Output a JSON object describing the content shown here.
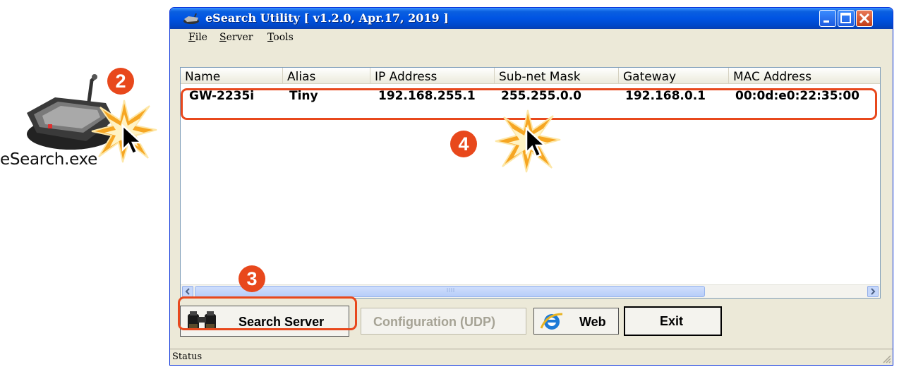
{
  "desktop": {
    "icon_name": "network-device-icon",
    "icon_label": "eSearch.exe"
  },
  "steps": {
    "step2": "2",
    "step3": "3",
    "step4": "4"
  },
  "window": {
    "title": "eSearch Utility [ v1.2.0, Apr.17, 2019 ]",
    "menu": [
      {
        "label": "File",
        "key": "F",
        "rest": "ile"
      },
      {
        "label": "Server",
        "key": "S",
        "rest": "erver"
      },
      {
        "label": "Tools",
        "key": "T",
        "rest": "ools"
      }
    ],
    "columns": [
      "Name",
      "Alias",
      "IP Address",
      "Sub-net Mask",
      "Gateway",
      "MAC Address"
    ],
    "rows": [
      {
        "name": "GW-2235i",
        "alias": "Tiny",
        "ip": "192.168.255.1",
        "mask": "255.255.0.0",
        "gateway": "192.168.0.1",
        "mac": "00:0d:e0:22:35:00"
      }
    ],
    "buttons": {
      "search": "Search Server",
      "config": "Configuration (UDP)",
      "web": "Web",
      "exit": "Exit"
    },
    "status": "Status"
  },
  "colors": {
    "accent": "#e8481c",
    "titlebar": "#0054e3",
    "window_bg": "#ece9d8"
  }
}
